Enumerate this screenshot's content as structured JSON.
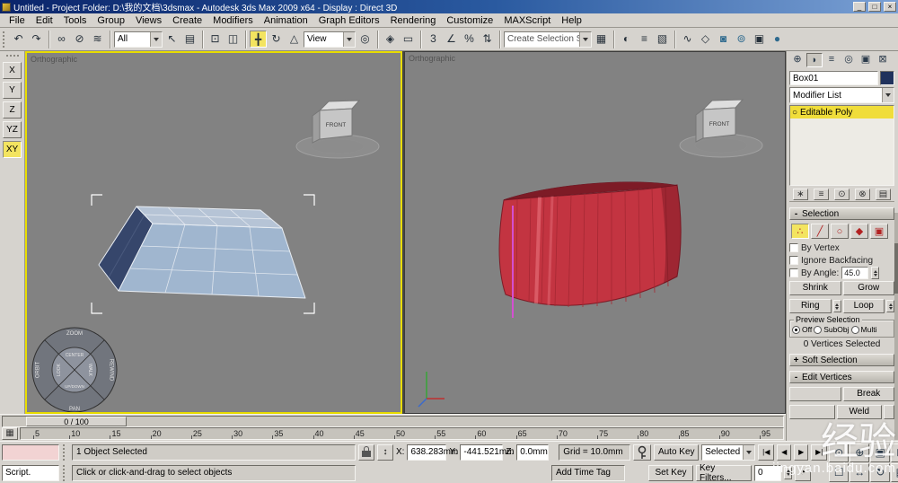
{
  "window": {
    "title": "Untitled - Project Folder: D:\\我的文档\\3dsmax - Autodesk 3ds Max 2009 x64 - Display : Direct 3D",
    "min": "_",
    "max": "□",
    "close": "×"
  },
  "menubar": [
    "File",
    "Edit",
    "Tools",
    "Group",
    "Views",
    "Create",
    "Modifiers",
    "Animation",
    "Graph Editors",
    "Rendering",
    "Customize",
    "MAXScript",
    "Help"
  ],
  "toolbar": {
    "filter": "All",
    "coord": "View",
    "selection_set": "Create Selection Set",
    "icons": [
      "↶",
      "↷",
      "∞",
      "⊘",
      "≋",
      "↖",
      "▤",
      "⊡",
      "◫",
      "╋",
      "↻",
      "△",
      "◎",
      "◈",
      "▭",
      "3",
      "∠",
      "%",
      "⇅",
      "▦",
      "◐",
      "≡",
      "▧",
      "∿",
      "◇",
      "◙",
      "⊚",
      "▣",
      "●"
    ]
  },
  "axis": {
    "items": [
      "X",
      "Y",
      "Z",
      "YZ",
      "XY"
    ]
  },
  "viewport_left": {
    "label": "Orthographic",
    "cube": "FRONT",
    "wheel": {
      "zoom": "ZOOM",
      "rewind": "REWIND",
      "pan": "PAN",
      "orbit": "ORBIT",
      "center": "CENTER",
      "walk": "WALK",
      "look": "LOOK",
      "updown": "UP/DOWN"
    }
  },
  "viewport_right": {
    "label": "Orthographic",
    "cube": "FRONT"
  },
  "command_panel": {
    "tabs": [
      "⊕",
      "◗",
      "≡",
      "◎",
      "▣",
      "⊠"
    ],
    "object_name": "Box01",
    "modifier_list": "Modifier List",
    "stack_bulb": "○",
    "stack_item": "Editable Poly",
    "stack_tools": [
      "∗",
      "≡",
      "⊙",
      "⊗",
      "▤"
    ],
    "sign_open": "-",
    "sign_closed": "+",
    "selection": {
      "title": "Selection",
      "subobj": [
        "∴",
        "╱",
        "○",
        "◆",
        "▣"
      ],
      "by_vertex": "By Vertex",
      "ignore_backfacing": "Ignore Backfacing",
      "by_angle": "By Angle:",
      "by_angle_value": "45.0",
      "shrink": "Shrink",
      "grow": "Grow",
      "ring": "Ring",
      "loop": "Loop",
      "preview_title": "Preview Selection",
      "preview_off": "Off",
      "preview_subobj": "SubObj",
      "preview_multi": "Multi",
      "status": "0 Vertices Selected"
    },
    "soft_selection": "Soft Selection",
    "edit_vertices": "Edit Vertices",
    "break": "Break",
    "weld": "Weld"
  },
  "timeline": {
    "slider": "0 / 100"
  },
  "trackbar": [
    "5",
    "10",
    "15",
    "20",
    "25",
    "30",
    "35",
    "40",
    "45",
    "50",
    "55",
    "60",
    "65",
    "70",
    "75",
    "80",
    "85",
    "90",
    "95"
  ],
  "statusbar": {
    "listener": "Script.",
    "status": "1 Object Selected",
    "prompt": "Click or click-and-drag to select objects",
    "x_label": "X:",
    "x": "638.283mm",
    "y_label": "Y:",
    "y": "-441.521mm",
    "z_label": "Z:",
    "z": "0.0mm",
    "grid": "Grid = 10.0mm",
    "add_time_tag": "Add Time Tag",
    "auto_key": "Auto Key",
    "set_key": "Set Key",
    "key_dropdown": "Selected",
    "key_filters": "Key Filters...",
    "frame": "0",
    "time_buttons": [
      "|◀",
      "◀",
      "▶",
      "▶|"
    ],
    "time_config": "◔",
    "nav": [
      "⊙",
      "⊕",
      "▣",
      "⊞",
      "☐",
      "↔",
      "↻",
      "▦"
    ]
  },
  "watermark": {
    "big": "经验",
    "small": "jingyan.baidu.com"
  }
}
